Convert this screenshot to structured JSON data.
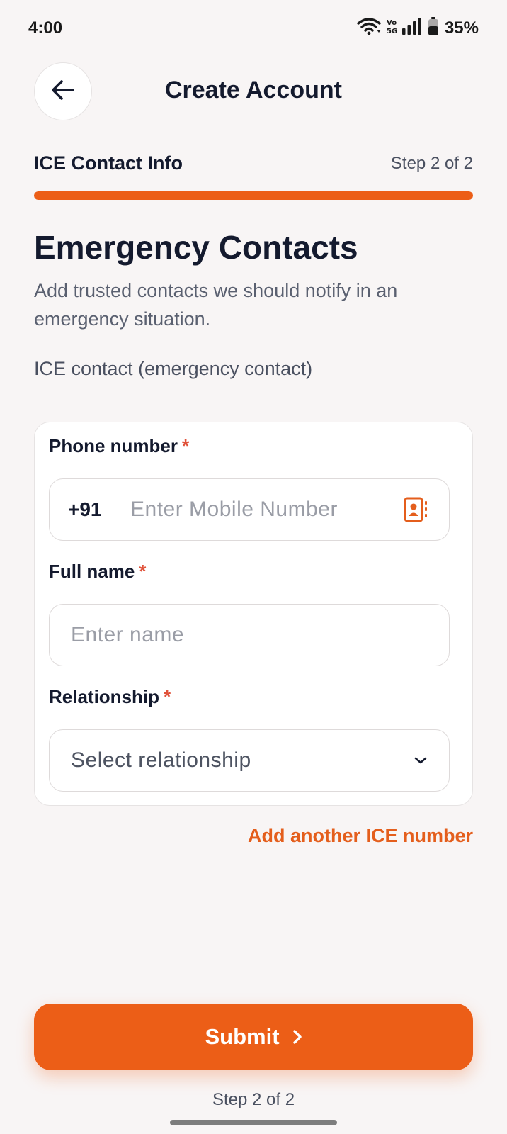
{
  "status_bar": {
    "time": "4:00",
    "battery": "35%",
    "icons": [
      "wifi-icon",
      "volte-icon",
      "signal-icon",
      "battery-icon"
    ]
  },
  "header": {
    "back_icon": "arrow-left-icon",
    "title": "Create Account"
  },
  "step": {
    "name": "ICE Contact Info",
    "count": "Step 2 of 2",
    "progress": 1.0
  },
  "section": {
    "heading": "Emergency Contacts",
    "description": "Add trusted contacts we should notify in an emergency situation.",
    "ice_label": "ICE contact (emergency contact)"
  },
  "form": {
    "phone": {
      "label": "Phone number",
      "required_mark": "*",
      "country_code": "+91",
      "placeholder": "Enter Mobile Number",
      "value": "",
      "icon": "contacts-book-icon"
    },
    "name": {
      "label": "Full name",
      "required_mark": "*",
      "placeholder": "Enter name",
      "value": ""
    },
    "relationship": {
      "label": "Relationship",
      "required_mark": "*",
      "selected": "Select relationship",
      "icon": "chevron-down-icon"
    }
  },
  "add_link": "Add another ICE number",
  "submit": {
    "label": "Submit",
    "icon": "chevron-right-icon"
  },
  "footer_step": "Step 2 of 2",
  "colors": {
    "accent": "#ec5e17",
    "required": "#e0523a",
    "background": "#f8f5f5"
  }
}
